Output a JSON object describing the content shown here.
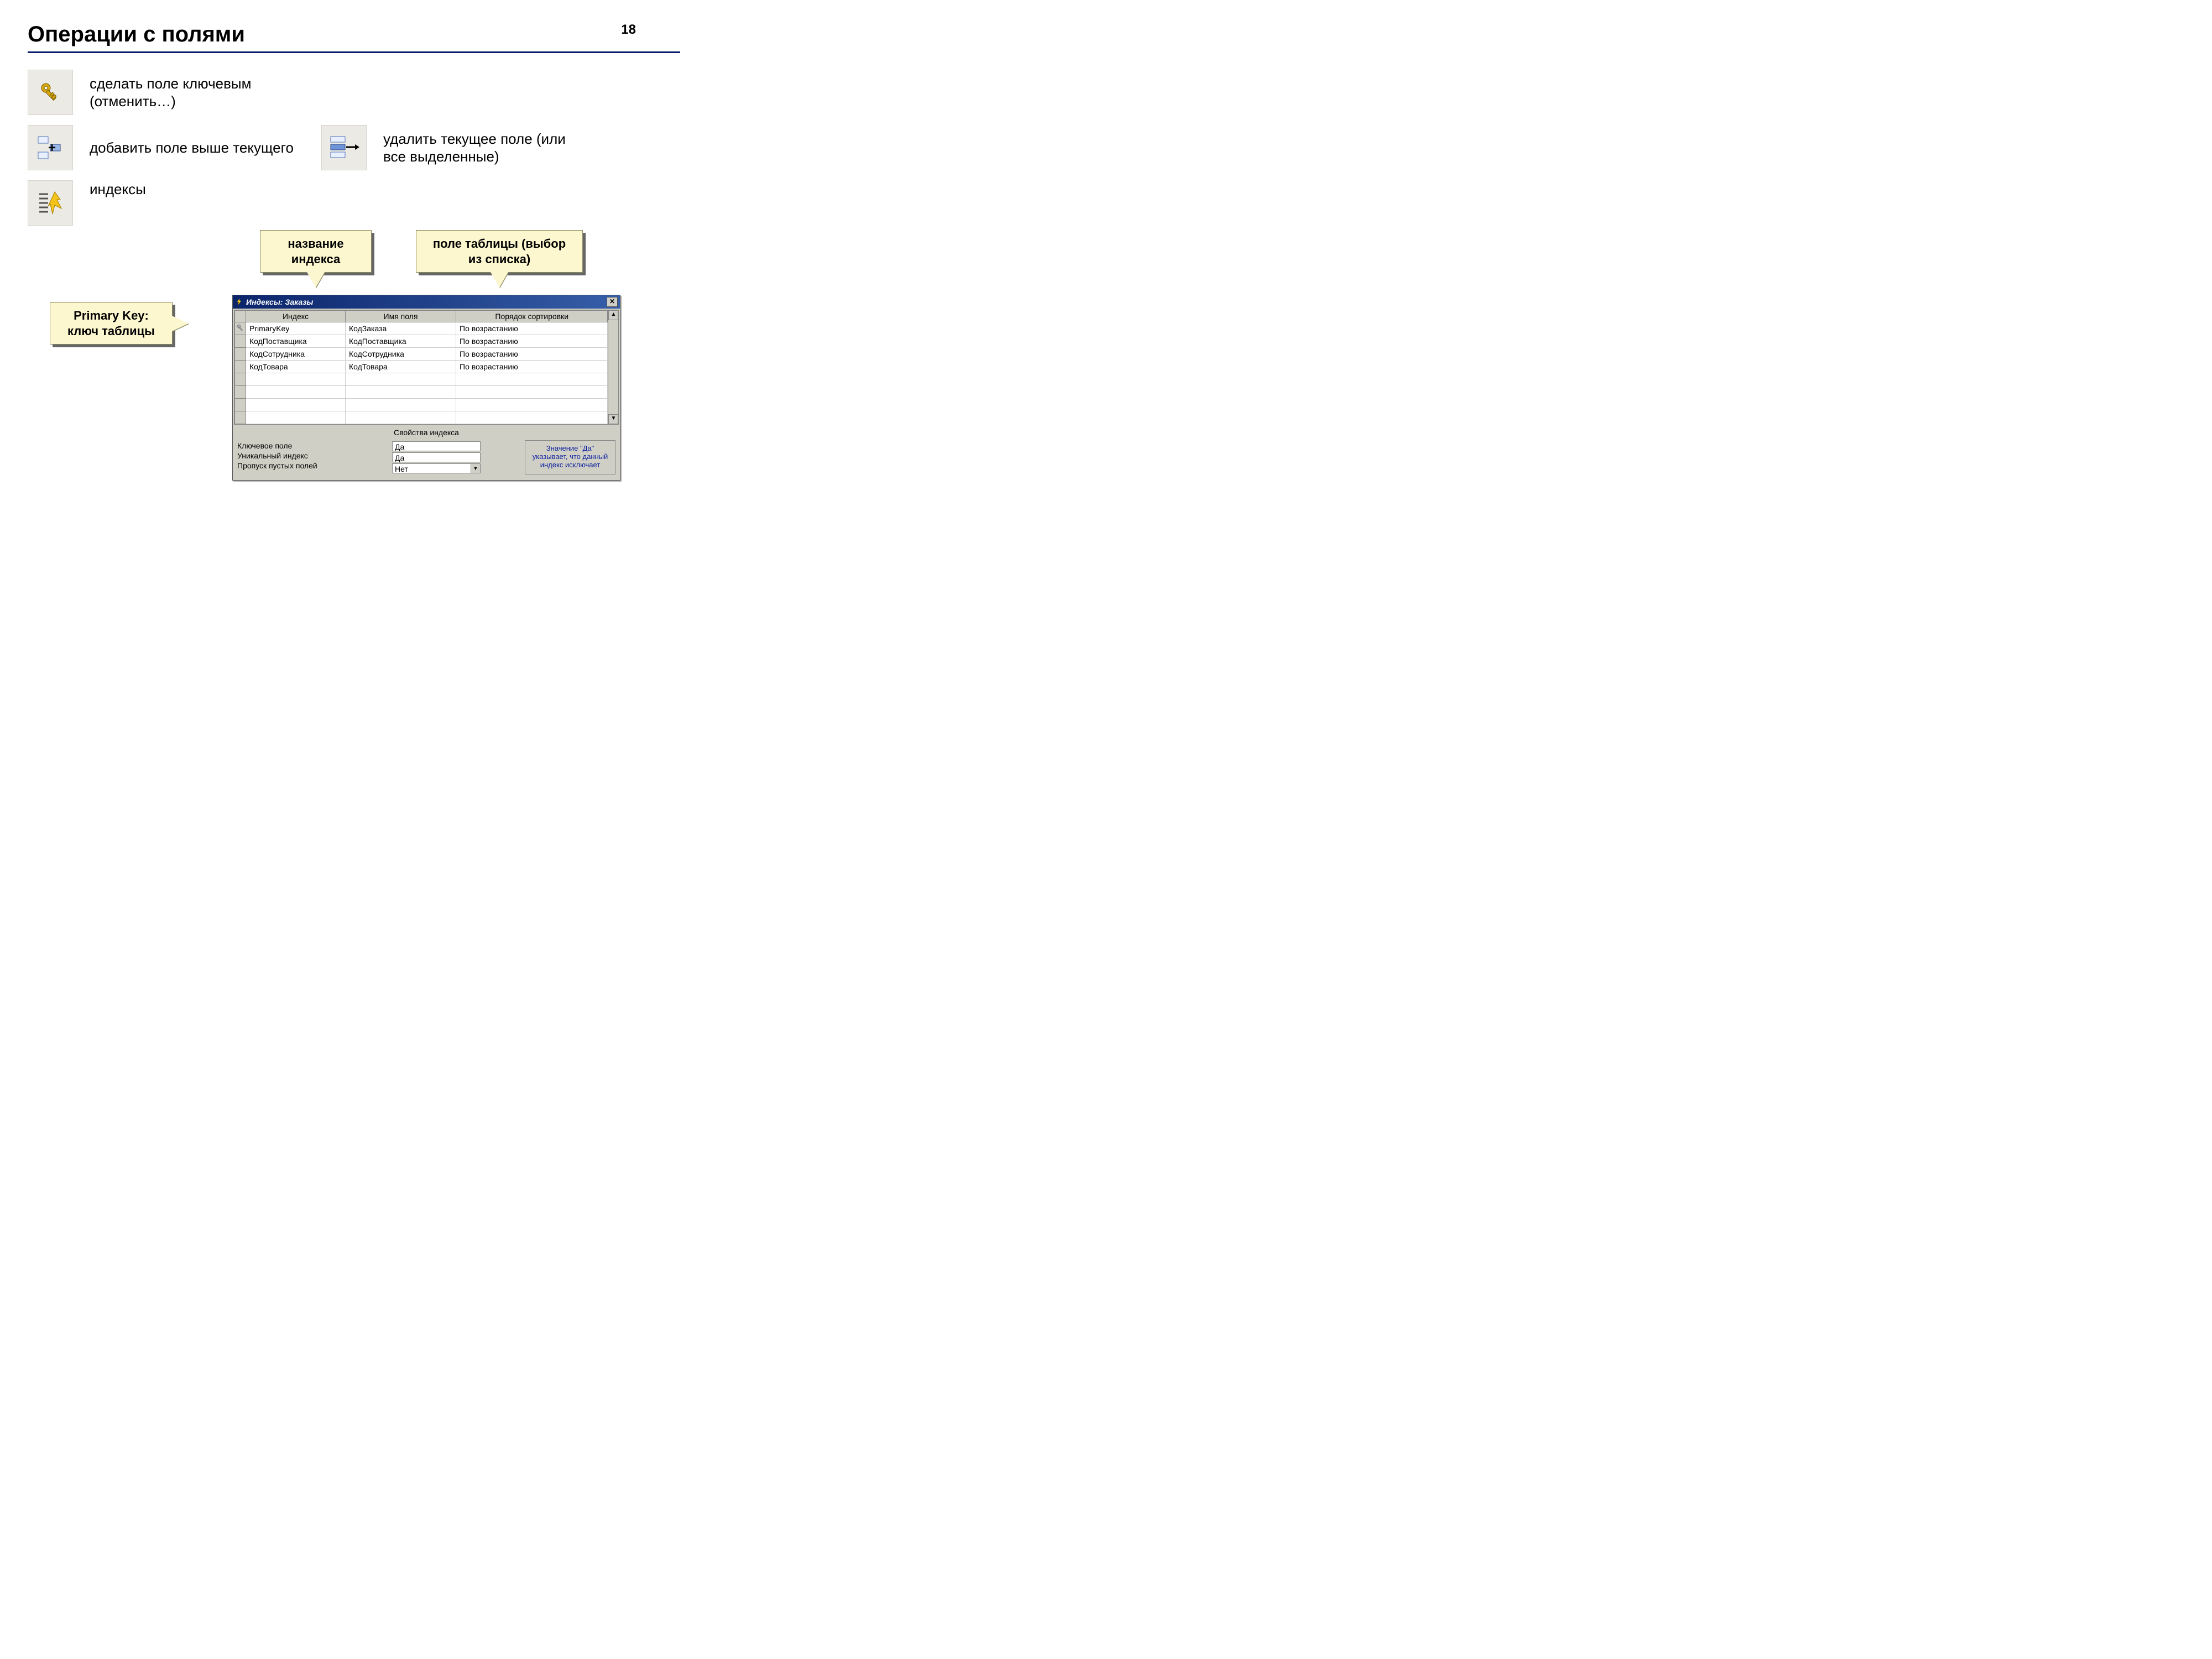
{
  "page_number": "18",
  "title": "Операции с полями",
  "ops": {
    "key": "сделать поле ключевым (отменить…)",
    "add": "добавить поле выше текущего",
    "delete": "удалить текущее поле (или все выделенные)",
    "indexes": "индексы"
  },
  "callouts": {
    "index_name": "название индекса",
    "table_field": "поле таблицы (выбор из списка)",
    "primary_key": "Primary Key: ключ таблицы"
  },
  "window": {
    "title": "Индексы: Заказы",
    "columns": [
      "Индекс",
      "Имя поля",
      "Порядок сортировки"
    ],
    "rows": [
      {
        "key": true,
        "index": "PrimaryKey",
        "field": "КодЗаказа",
        "sort": "По возрастанию"
      },
      {
        "key": false,
        "index": "КодПоставщика",
        "field": "КодПоставщика",
        "sort": "По возрастанию"
      },
      {
        "key": false,
        "index": "КодСотрудника",
        "field": "КодСотрудника",
        "sort": "По возрастанию"
      },
      {
        "key": false,
        "index": "КодТовара",
        "field": "КодТовара",
        "sort": "По возрастанию"
      }
    ],
    "props_title": "Свойства индекса",
    "props": [
      {
        "label": "Ключевое поле",
        "value": "Да",
        "combo": false
      },
      {
        "label": "Уникальный индекс",
        "value": "Да",
        "combo": false
      },
      {
        "label": "Пропуск пустых полей",
        "value": "Нет",
        "combo": true
      }
    ],
    "help": "Значение \"Да\" указывает, что данный индекс исключает"
  }
}
